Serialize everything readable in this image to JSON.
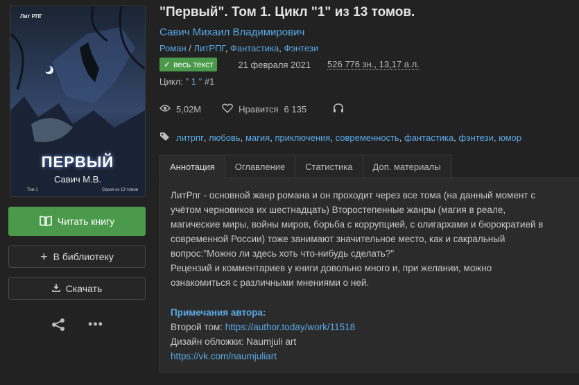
{
  "cover": {
    "publisher": "Лит РПГ",
    "title": "ПЕРВЫЙ",
    "author": "Савич М.В.",
    "volume": "Том 1",
    "series": "Серия из 13 томов"
  },
  "actions": {
    "read": "Читать книгу",
    "library": "В библиотеку",
    "download": "Скачать"
  },
  "book": {
    "title": "\"Первый\". Том 1. Цикл \"1\" из 13 томов.",
    "author": "Савич Михаил Владимирович",
    "genres": [
      "Роман",
      "ЛитРПГ",
      "Фантастика",
      "Фэнтези"
    ],
    "badge": "весь текст",
    "date": "21 февраля 2021",
    "size": "526 776 зн., 13,17 а.л.",
    "cycle_label": "Цикл:",
    "cycle_name": "\" 1 \"",
    "cycle_num": "#1"
  },
  "stats": {
    "views": "5,02М",
    "likes_label": "Нравится",
    "likes": "6 135"
  },
  "tags": [
    "литрпг",
    "любовь",
    "магия",
    "приключения",
    "современность",
    "фантастика",
    "фэнтези",
    "юмор"
  ],
  "tabs": [
    "Аннотация",
    "Оглавление",
    "Статистика",
    "Доп. материалы"
  ],
  "annotation": {
    "lines": [
      "ЛитРпг - основной жанр романа и он проходит через все тома (на данный момент с",
      "учётом черновиков их шестнадцать) Второстепенные жанры (магия в реале,",
      "магические миры, войны миров, борьба с коррупцией, с олигархами и бюрократией в",
      "современной России) тоже занимают значительное место, как и сакральный",
      "вопрос:\"Можно ли здесь хоть что-нибудь сделать?\"",
      "Рецензий и комментариев у книги довольно много и, при желании, можно",
      "ознакомиться с различными мнениями о ней."
    ],
    "notes_title": "Примечания автора:",
    "second_vol_label": "Второй том:",
    "second_vol_link": "https://author.today/work/11518",
    "cover_design": "Дизайн обложки: Naumjuli art",
    "vk_link": "https://vk.com/naumjuliart"
  },
  "colors": {
    "accent": "#5aa9e6",
    "green": "#4b9a4b",
    "bg": "#222222"
  }
}
